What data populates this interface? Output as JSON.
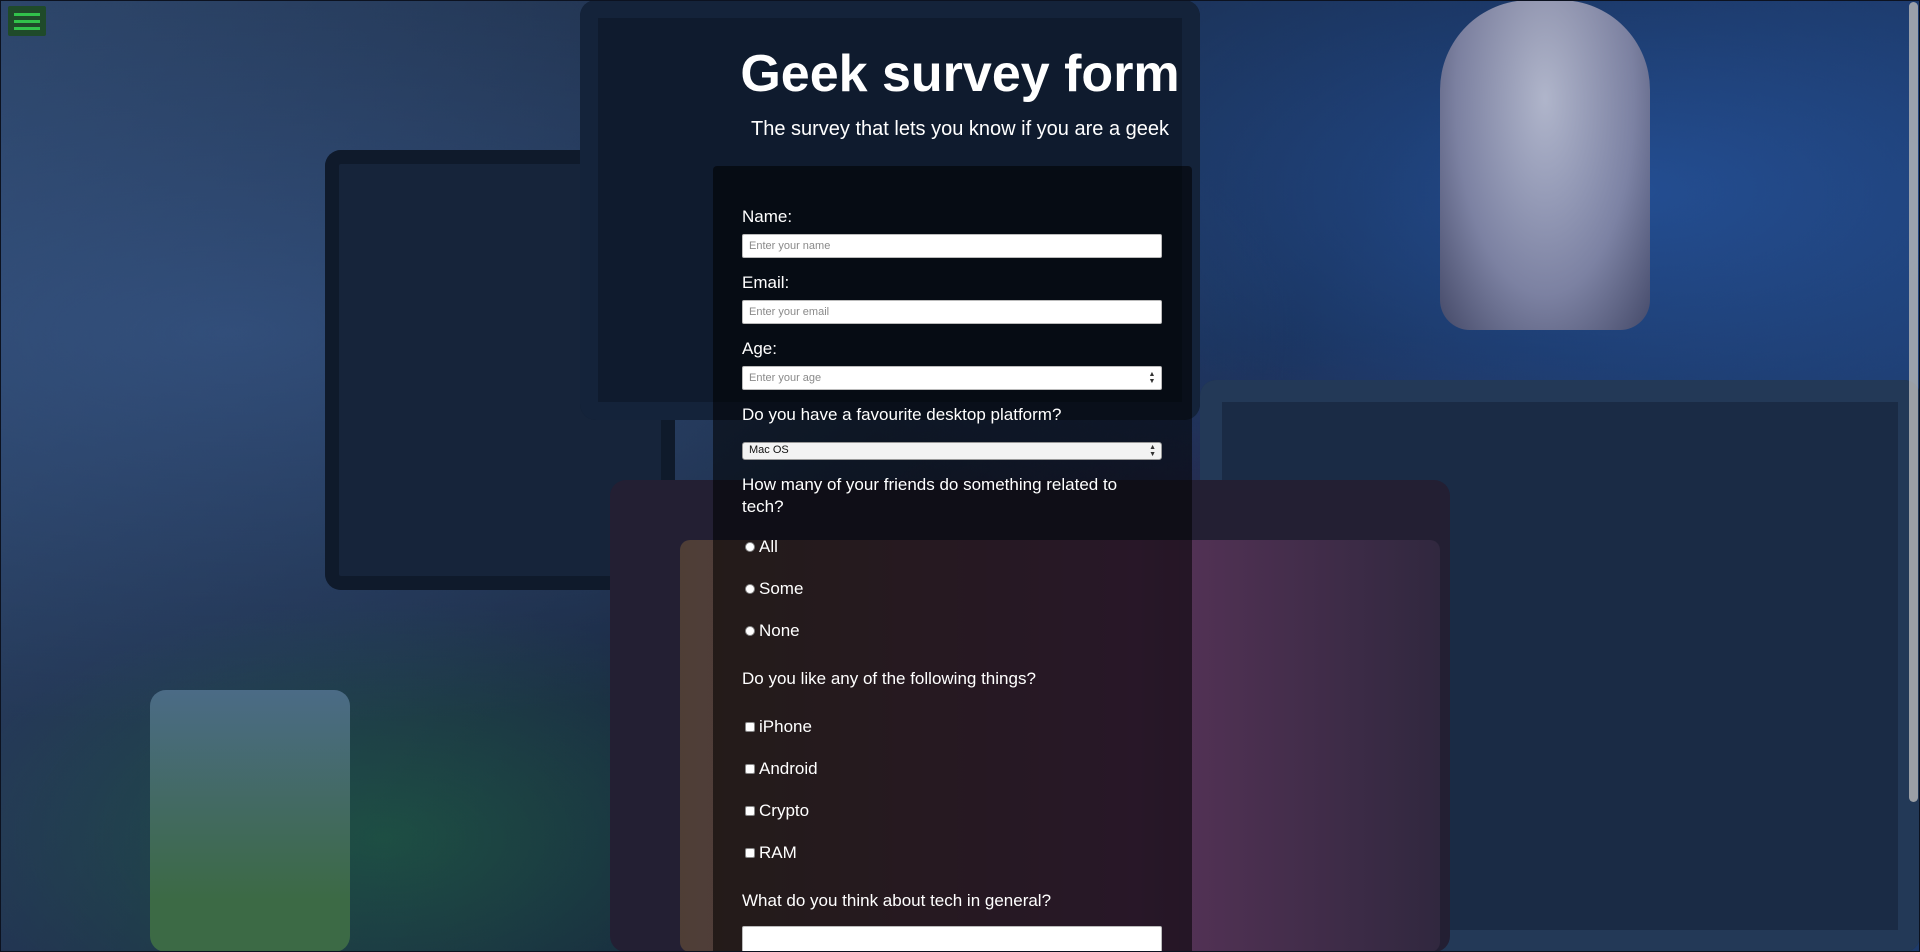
{
  "header": {
    "title": "Geek survey form",
    "subtitle": "The survey that lets you know if you are a geek"
  },
  "menu": {
    "icon": "hamburger-menu-icon",
    "accent_color": "#31c24b"
  },
  "form": {
    "name": {
      "label": "Name:",
      "placeholder": "Enter your name"
    },
    "email": {
      "label": "Email:",
      "placeholder": "Enter your email"
    },
    "age": {
      "label": "Age:",
      "placeholder": "Enter your age"
    },
    "platform": {
      "label": "Do you have a favourite desktop platform?",
      "selected": "Mac OS"
    },
    "friends": {
      "label": "How many of your friends do something related to tech?",
      "options": [
        "All",
        "Some",
        "None"
      ]
    },
    "likes": {
      "label": "Do you like any of the following things?",
      "options": [
        "iPhone",
        "Android",
        "Crypto",
        "RAM"
      ]
    },
    "opinion": {
      "label": "What do you think about tech in general?"
    }
  }
}
